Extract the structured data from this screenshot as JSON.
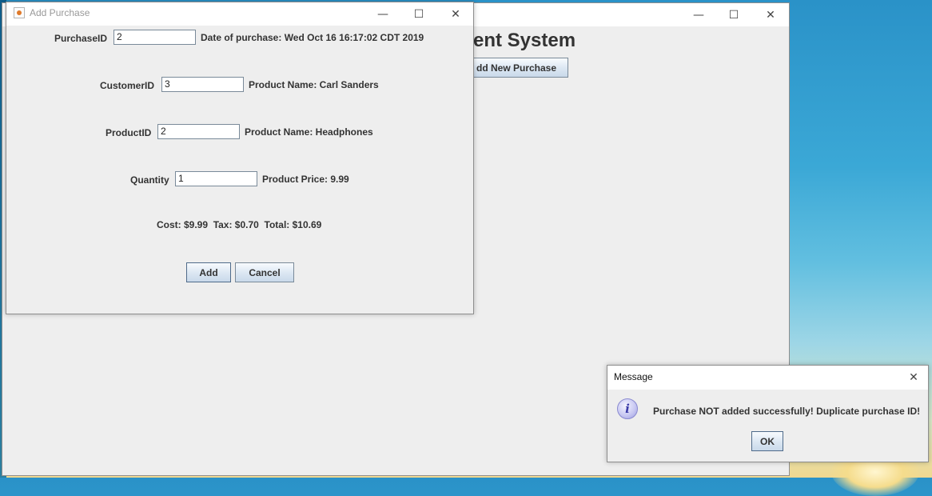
{
  "main_window": {
    "heading_partial": "ent System",
    "add_new_purchase_partial": "dd New Purchase",
    "controls": {
      "minimize": "—",
      "maximize": "☐",
      "close": "✕"
    }
  },
  "dialog": {
    "title": "Add Purchase",
    "controls": {
      "minimize": "—",
      "maximize": "☐",
      "close": "✕"
    },
    "purchase_id": {
      "label": "PurchaseID",
      "value": "2",
      "info": "Date of purchase: Wed Oct 16 16:17:02 CDT 2019"
    },
    "customer_id": {
      "label": "CustomerID",
      "value": "3",
      "info": "Product Name: Carl Sanders"
    },
    "product_id": {
      "label": "ProductID",
      "value": "2",
      "info": "Product Name: Headphones"
    },
    "quantity": {
      "label": "Quantity",
      "value": "1",
      "info": "Product Price: 9.99"
    },
    "totals": "Cost: $9.99  Tax: $0.70  Total: $10.69",
    "add_label": "Add",
    "cancel_label": "Cancel"
  },
  "message": {
    "title": "Message",
    "close": "✕",
    "icon": "info-icon",
    "text": "Purchase NOT added successfully! Duplicate purchase ID!",
    "ok_label": "OK"
  }
}
